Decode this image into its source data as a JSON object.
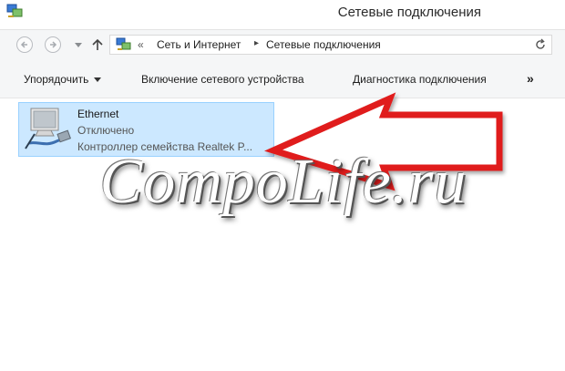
{
  "window": {
    "title": "Сетевые подключения"
  },
  "nav": {
    "back_icon": "back-arrow-icon",
    "forward_icon": "forward-arrow-icon",
    "up_icon": "up-arrow-icon",
    "chevron": "«",
    "breadcrumb": [
      "Сеть и Интернет",
      "Сетевые подключения"
    ],
    "separator": "▸"
  },
  "toolbar": {
    "organize_label": "Упорядочить",
    "enable_label": "Включение сетевого устройства",
    "diagnose_label": "Диагностика подключения",
    "more_label": "»"
  },
  "connection": {
    "name": "Ethernet",
    "status": "Отключено",
    "device": "Контроллер семейства Realtek P..."
  },
  "watermark": "CompoLife.ru",
  "colors": {
    "selection_bg": "#cce8ff",
    "selection_border": "#99d1ff",
    "arrow": "#e01d1d"
  }
}
